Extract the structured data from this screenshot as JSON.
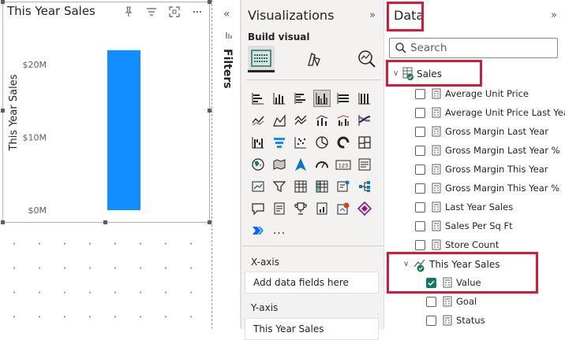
{
  "visual": {
    "title": "This Year Sales",
    "icons": [
      "pin-icon",
      "filter-icon",
      "focus-mode-icon",
      "more-options-icon"
    ]
  },
  "chart_data": {
    "type": "bar",
    "categories": [
      ""
    ],
    "values": [
      22
    ],
    "series": [
      {
        "name": "This Year Sales",
        "values": [
          22
        ]
      }
    ],
    "ylabel": "This Year Sales",
    "xlabel": "",
    "ylim": [
      0,
      25
    ],
    "yticks": [
      "$0M",
      "$10M",
      "$20M"
    ],
    "ytick_values": [
      0,
      10,
      20
    ],
    "bar_color": "#118dff",
    "grid": false
  },
  "filters": {
    "label": "Filters"
  },
  "visualizations": {
    "title": "Visualizations",
    "build_label": "Build visual",
    "more": "...",
    "xaxis_label": "X-axis",
    "xaxis_placeholder": "Add data fields here",
    "yaxis_label": "Y-axis",
    "yaxis_value": "This Year Sales"
  },
  "data": {
    "title": "Data",
    "search_placeholder": "Search",
    "table": "Sales",
    "fields": [
      "Average Unit Price",
      "Average Unit Price Last Year",
      "Gross Margin Last Year",
      "Gross Margin Last Year %",
      "Gross Margin This Year",
      "Gross Margin This Year %",
      "Last Year Sales",
      "Sales Per Sq Ft",
      "Store Count"
    ],
    "kpi": {
      "name": "This Year Sales",
      "children": [
        {
          "label": "Value",
          "checked": true
        },
        {
          "label": "Goal",
          "checked": false
        },
        {
          "label": "Status",
          "checked": false
        }
      ]
    }
  },
  "colors": {
    "accent": "#118dff",
    "highlight": "#d61a3c",
    "check": "#117865"
  }
}
